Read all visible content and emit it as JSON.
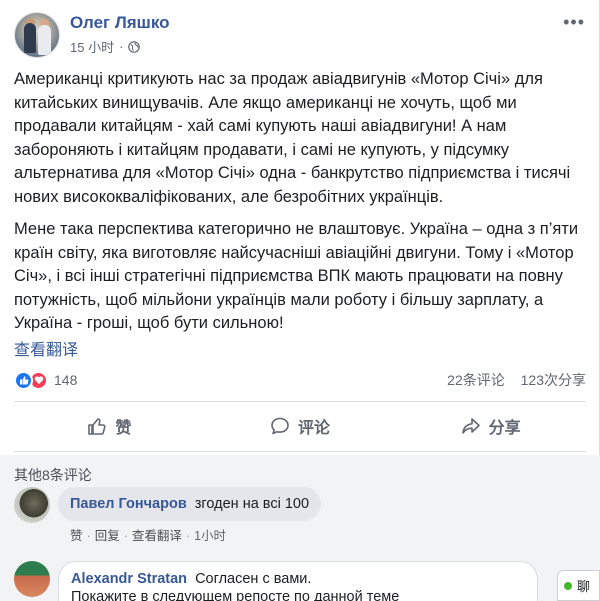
{
  "post": {
    "author": "Олег Ляшко",
    "time": "15 小时",
    "time_separator": "·",
    "paragraphs": [
      "Американці критикують нас за продаж авіадвигунів «Мотор Січі» для китайських винищувачів. Але якщо американці не хочуть, щоб ми продавали китайцям - хай самі купують наші авіадвигуни! А нам забороняють і китайцям продавати, і самі не купують, у підсумку альтернатива для «Мотор Січі» одна - банкрутство підприємства і тисячі нових висококваліфікованих, але безробітних українців.",
      "Мене така перспектива категорично не влаштовує. Україна – одна з п’яти країн світу, яка виготовляє найсучасніші авіаційні двигуни. Тому і «Мотор Січ», і всі інші стратегічні підприємства ВПК мають працювати на повну потужність, щоб мільйони українців мали роботу і більшу зарплату, а Україна - гроші, щоб бути сильною!"
    ],
    "see_translation": "查看翻译"
  },
  "reactions": {
    "count": "148",
    "comments": "22条评论",
    "shares": "123次分享"
  },
  "actions": {
    "like": "赞",
    "comment": "评论",
    "share": "分享"
  },
  "comments": {
    "more": "其他8条评论",
    "items": [
      {
        "name": "Павел Гончаров",
        "text": "згоден на всі 100",
        "like": "赞",
        "reply": "回复",
        "translate": "查看翻译",
        "time": "1小时",
        "sep": "·"
      },
      {
        "name": "Alexandr Stratan",
        "text_line1": "Согласен с вами.",
        "text_line2": "Покажите в следующем репосте по данной теме"
      }
    ]
  },
  "chat": {
    "label": "聊"
  },
  "colors": {
    "link": "#385898",
    "like_blue": "#1877f2",
    "love_red": "#f33e58",
    "muted": "#606770"
  }
}
